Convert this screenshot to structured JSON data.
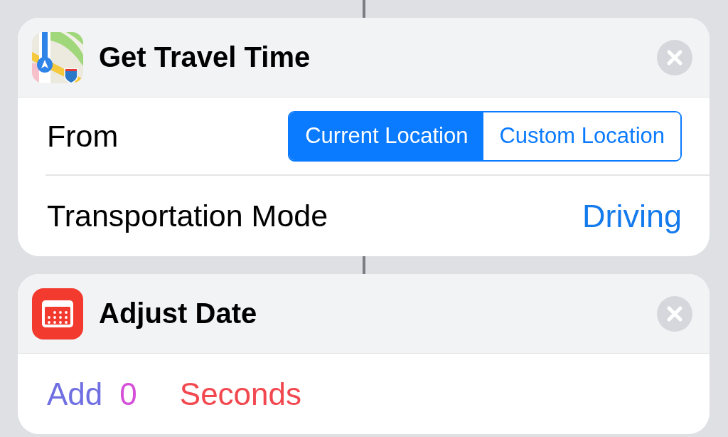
{
  "actions": [
    {
      "kind": "maps",
      "title": "Get Travel Time",
      "rows": [
        {
          "kind": "segmented",
          "label": "From",
          "options": [
            {
              "label": "Current Location",
              "selected": true
            },
            {
              "label": "Custom Location",
              "selected": false
            }
          ]
        },
        {
          "kind": "value",
          "label": "Transportation Mode",
          "value": "Driving"
        }
      ]
    },
    {
      "kind": "calendar",
      "title": "Adjust Date",
      "rows": [
        {
          "kind": "tokens",
          "tokens": [
            {
              "kind": "word",
              "text": "Add",
              "color": "#6f6fe2"
            },
            {
              "kind": "number",
              "text": "0",
              "color": "#d54ed8"
            },
            {
              "kind": "word",
              "text": "Seconds",
              "color": "#f2484f"
            }
          ]
        }
      ]
    }
  ]
}
